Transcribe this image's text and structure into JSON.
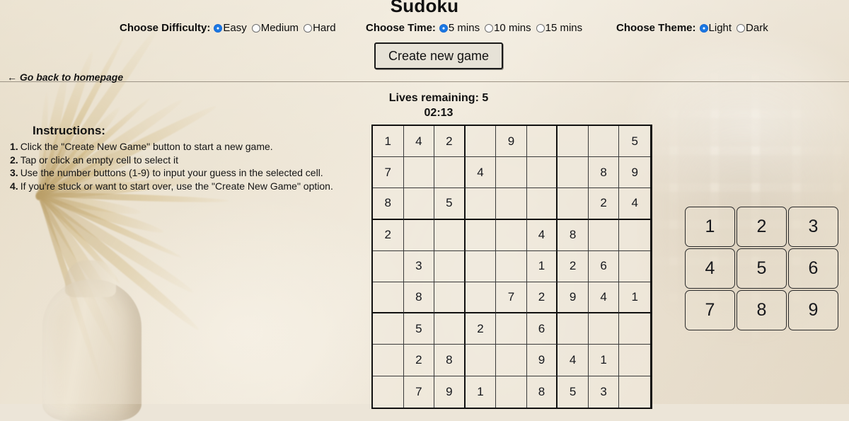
{
  "header": {
    "title": "Sudoku",
    "difficulty": {
      "label": "Choose Difficulty:",
      "options": [
        {
          "label": "Easy",
          "selected": true
        },
        {
          "label": "Medium",
          "selected": false
        },
        {
          "label": "Hard",
          "selected": false
        }
      ]
    },
    "time": {
      "label": "Choose Time:",
      "options": [
        {
          "label": "5 mins",
          "selected": true
        },
        {
          "label": "10 mins",
          "selected": false
        },
        {
          "label": "15 mins",
          "selected": false
        }
      ]
    },
    "theme": {
      "label": "Choose Theme:",
      "options": [
        {
          "label": "Light",
          "selected": true
        },
        {
          "label": "Dark",
          "selected": false
        }
      ]
    },
    "create_button": "Create new game",
    "back_link": "← Go back to homepage"
  },
  "status": {
    "lives": "Lives remaining: 5",
    "timer": "02:13"
  },
  "instructions": {
    "heading": "Instructions:",
    "items": [
      {
        "num": "1.",
        "text": "Click the \"Create New Game\" button to start a new game."
      },
      {
        "num": "2.",
        "text": "Tap or click an empty cell to select it"
      },
      {
        "num": "3.",
        "text": "Use the number buttons (1-9) to input your guess in the selected cell."
      },
      {
        "num": "4.",
        "text": "If you're stuck or want to start over, use the \"Create New Game\" option."
      }
    ]
  },
  "board": {
    "rows": [
      [
        "1",
        "4",
        "2",
        "",
        "9",
        "",
        "",
        "",
        "5"
      ],
      [
        "7",
        "",
        "",
        "4",
        "",
        "",
        "",
        "8",
        "9"
      ],
      [
        "8",
        "",
        "5",
        "",
        "",
        "",
        "",
        "2",
        "4"
      ],
      [
        "2",
        "",
        "",
        "",
        "",
        "4",
        "8",
        "",
        ""
      ],
      [
        "",
        "3",
        "",
        "",
        "",
        "1",
        "2",
        "6",
        ""
      ],
      [
        "",
        "8",
        "",
        "",
        "7",
        "2",
        "9",
        "4",
        "1"
      ],
      [
        "",
        "5",
        "",
        "2",
        "",
        "6",
        "",
        "",
        ""
      ],
      [
        "",
        "2",
        "8",
        "",
        "",
        "9",
        "4",
        "1",
        ""
      ],
      [
        "",
        "7",
        "9",
        "1",
        "",
        "8",
        "5",
        "3",
        ""
      ]
    ]
  },
  "numpad": {
    "keys": [
      "1",
      "2",
      "3",
      "4",
      "5",
      "6",
      "7",
      "8",
      "9"
    ]
  },
  "colors": {
    "accent": "#1b78e2",
    "text": "#111111",
    "grid_line": "#3a3a3a",
    "grid_border": "#111111",
    "page_background": "#e9e0ce"
  }
}
